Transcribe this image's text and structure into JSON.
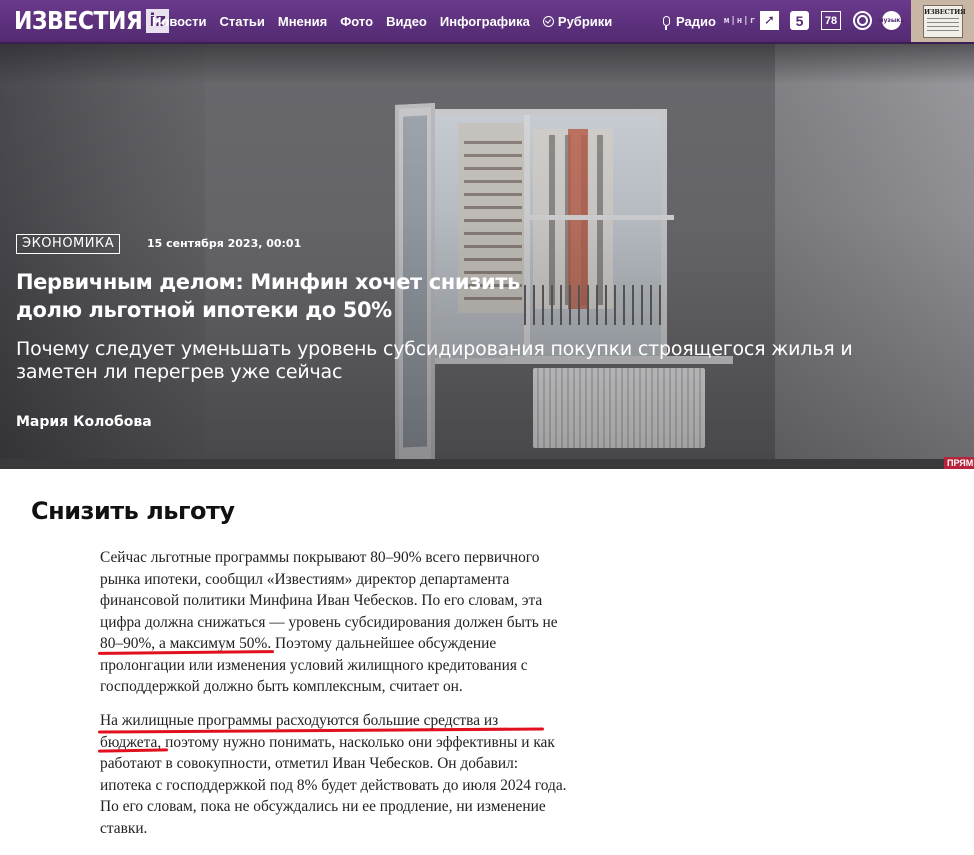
{
  "header": {
    "logo_text": "ИЗВЕСТИЯ",
    "logo_iz": "iz",
    "nav": [
      "Новости",
      "Статьи",
      "Мнения",
      "Фото",
      "Видео",
      "Инфографика"
    ],
    "rubriki_label": "Рубрики",
    "radio_label": "Радио",
    "radio_tag": "м|н|r",
    "media": {
      "five": "5",
      "seventy_eight": "78",
      "circle": "музыка"
    },
    "paper_title": "ИЗВЕСТИЯ",
    "brand_color": "#532a72"
  },
  "hero": {
    "rubric": "ЭКОНОМИКА",
    "date": "15 сентября 2023, 00:01",
    "title_lines": [
      "Первичным делом: Минфин хочет снизить",
      "долю льготной ипотеки до 50%"
    ],
    "subtitle_lines": [
      "Почему следует уменьшать уровень субсидирования покупки строящегося жилья и",
      "заметен ли перегрев уже сейчас"
    ],
    "author": "Мария Колобова",
    "corner_badge": "ПРЯМ"
  },
  "article": {
    "heading": "Снизить льготу",
    "paragraph1_lines": [
      "Сейчас льготные программы покрывают 80–90% всего первичного",
      "рынка ипотеки, сообщил «Известиям» директор департамента",
      "финансовой политики Минфина Иван Чебесков. По его словам, эта",
      "цифра должна снижаться — уровень субсидирования должен быть не",
      "80–90%, а максимум 50%. Поэтому дальнейшее обсуждение",
      "пролонгации или изменения условий жилищного кредитования с",
      "господдержкой должно быть комплексным, считает он."
    ],
    "paragraph2_lines": [
      "На жилищные программы расходуются большие средства из",
      "бюджета, поэтому нужно понимать, насколько они эффективны и как",
      "работают в совокупности, отметил Иван Чебесков. Он добавил:",
      "ипотека с господдержкой под 8% будет действовать до июля 2024 года.",
      "По его словам, пока не обсуждались ни ее продление, ни изменение",
      "ставки."
    ],
    "highlight_color": "#e0101e"
  }
}
